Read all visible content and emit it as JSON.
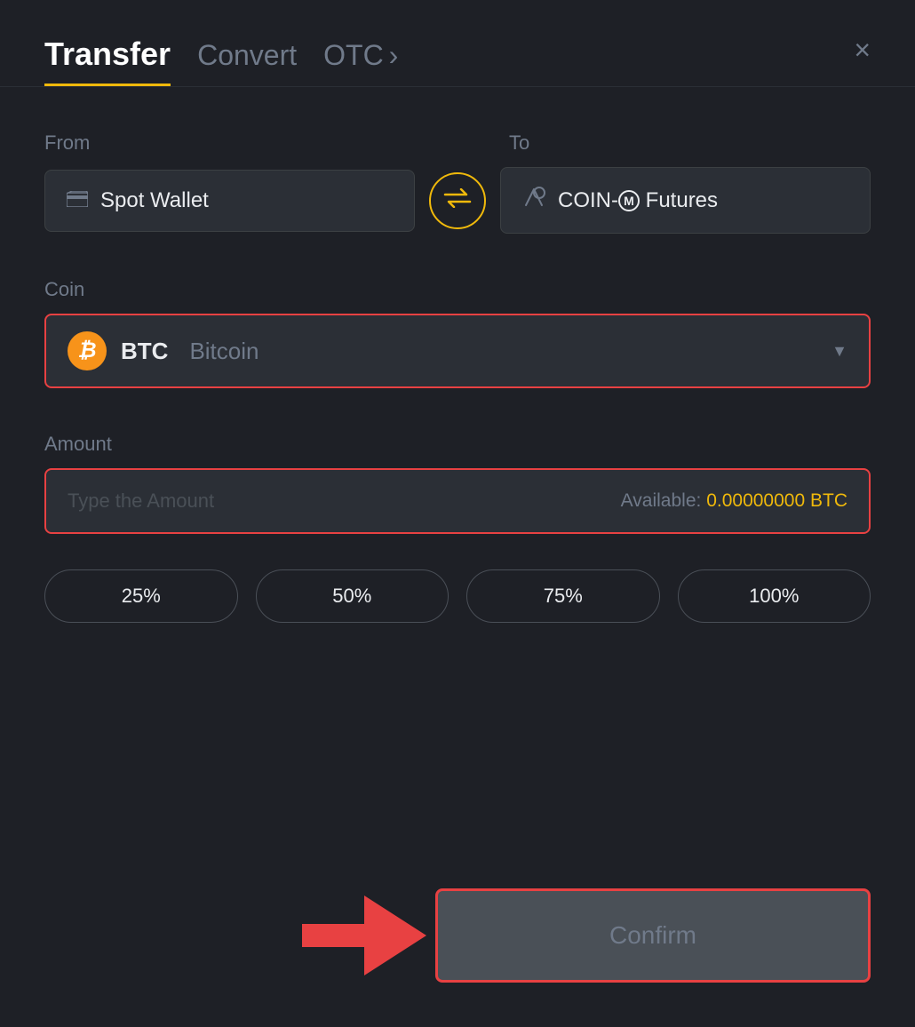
{
  "header": {
    "tab_transfer": "Transfer",
    "tab_convert": "Convert",
    "tab_otc": "OTC",
    "chevron": "›",
    "close": "×"
  },
  "from": {
    "label": "From",
    "wallet": "Spot Wallet",
    "wallet_icon": "🪪"
  },
  "to": {
    "label": "To",
    "futures": "COIN-Ⓜ Futures",
    "futures_icon": "↑"
  },
  "coin": {
    "label": "Coin",
    "symbol": "BTC",
    "name": "Bitcoin",
    "icon_letter": "₿"
  },
  "amount": {
    "label": "Amount",
    "placeholder": "Type the Amount",
    "available_label": "Available:",
    "available_value": "0.00000000 BTC"
  },
  "percentages": [
    "25%",
    "50%",
    "75%",
    "100%"
  ],
  "confirm": {
    "label": "Confirm"
  }
}
